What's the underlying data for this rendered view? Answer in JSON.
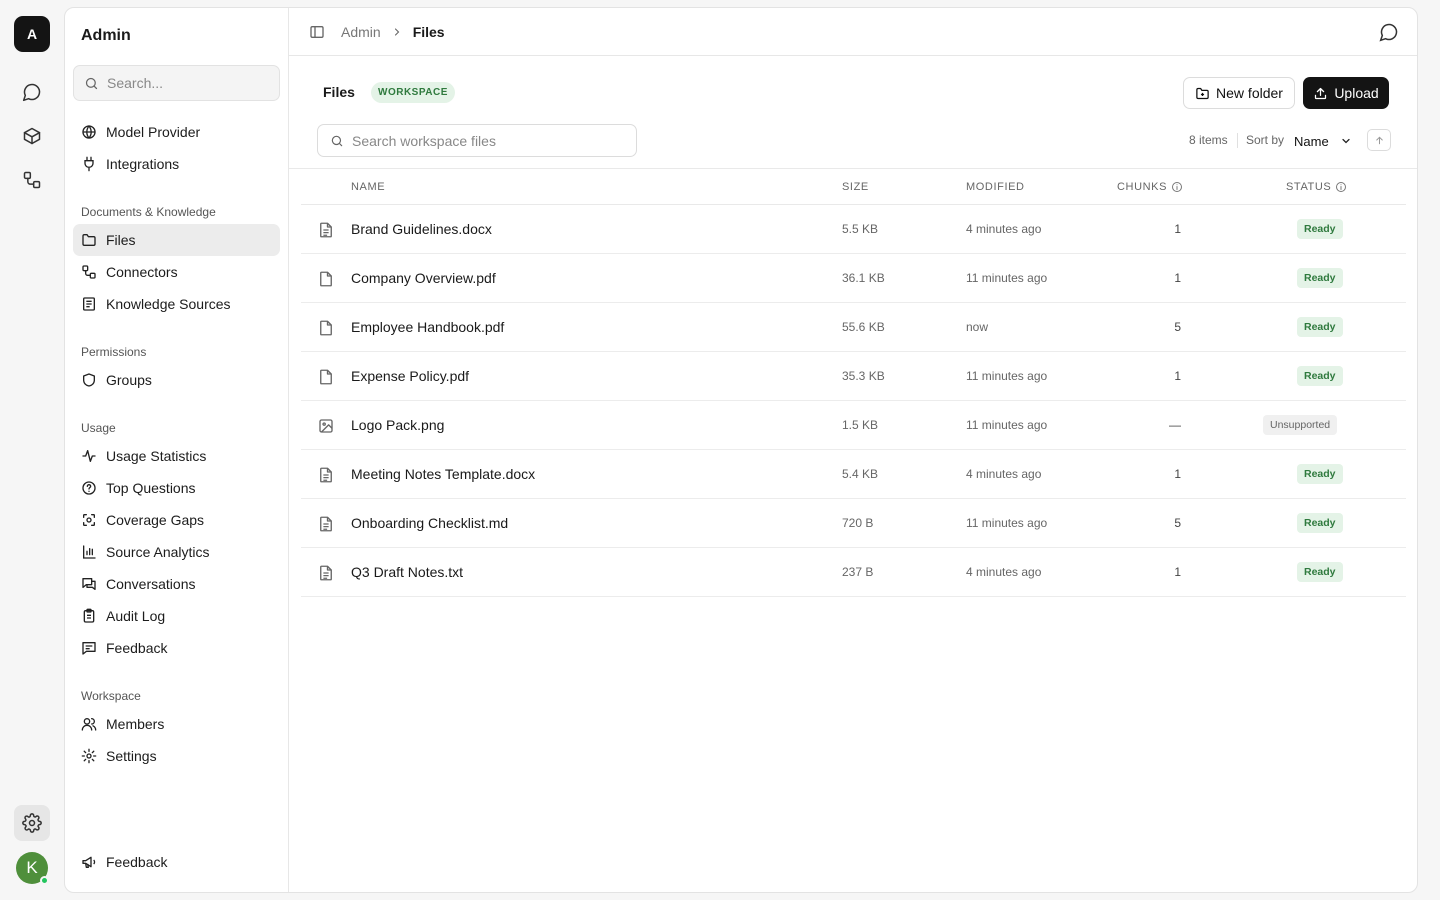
{
  "rail": {
    "logo": "A",
    "avatar": "K",
    "icons": [
      "chat-icon",
      "cube-icon",
      "workflow-icon",
      "gear-icon"
    ]
  },
  "sidebar": {
    "title": "Admin",
    "search_placeholder": "Search...",
    "top_items": [
      {
        "label": "Model Provider",
        "icon": "globe-icon"
      },
      {
        "label": "Integrations",
        "icon": "plug-icon"
      }
    ],
    "groups": [
      {
        "label": "Documents & Knowledge",
        "items": [
          {
            "label": "Files",
            "icon": "folder-icon",
            "active": true
          },
          {
            "label": "Connectors",
            "icon": "connectors-icon"
          },
          {
            "label": "Knowledge Sources",
            "icon": "book-icon"
          }
        ]
      },
      {
        "label": "Permissions",
        "items": [
          {
            "label": "Groups",
            "icon": "shield-icon"
          }
        ]
      },
      {
        "label": "Usage",
        "items": [
          {
            "label": "Usage Statistics",
            "icon": "activity-icon"
          },
          {
            "label": "Top Questions",
            "icon": "help-circle-icon"
          },
          {
            "label": "Coverage Gaps",
            "icon": "scan-icon"
          },
          {
            "label": "Source Analytics",
            "icon": "bar-chart-icon"
          },
          {
            "label": "Conversations",
            "icon": "messages-icon"
          },
          {
            "label": "Audit Log",
            "icon": "clipboard-icon"
          },
          {
            "label": "Feedback",
            "icon": "message-square-icon"
          }
        ]
      },
      {
        "label": "Workspace",
        "items": [
          {
            "label": "Members",
            "icon": "users-icon"
          },
          {
            "label": "Settings",
            "icon": "gear-icon"
          }
        ]
      }
    ],
    "bottom_item": {
      "label": "Feedback",
      "icon": "megaphone-icon"
    }
  },
  "topbar": {
    "breadcrumb": [
      "Admin",
      "Files"
    ]
  },
  "header": {
    "title": "Files",
    "badge": "WORKSPACE",
    "new_folder_label": "New folder",
    "upload_label": "Upload"
  },
  "toolbar": {
    "search_placeholder": "Search workspace files",
    "items_count": "8 items",
    "sort_by_label": "Sort by",
    "sort_value": "Name"
  },
  "table": {
    "columns": {
      "name": "NAME",
      "size": "SIZE",
      "modified": "MODIFIED",
      "chunks": "CHUNKS",
      "status": "STATUS"
    },
    "rows": [
      {
        "name": "Brand Guidelines.docx",
        "size": "5.5 KB",
        "modified": "4 minutes ago",
        "chunks": "1",
        "status": "Ready",
        "type": "doc"
      },
      {
        "name": "Company Overview.pdf",
        "size": "36.1 KB",
        "modified": "11 minutes ago",
        "chunks": "1",
        "status": "Ready",
        "type": "file"
      },
      {
        "name": "Employee Handbook.pdf",
        "size": "55.6 KB",
        "modified": "now",
        "chunks": "5",
        "status": "Ready",
        "type": "file"
      },
      {
        "name": "Expense Policy.pdf",
        "size": "35.3 KB",
        "modified": "11 minutes ago",
        "chunks": "1",
        "status": "Ready",
        "type": "file"
      },
      {
        "name": "Logo Pack.png",
        "size": "1.5 KB",
        "modified": "11 minutes ago",
        "chunks": "—",
        "status": "Unsupported",
        "type": "image"
      },
      {
        "name": "Meeting Notes Template.docx",
        "size": "5.4 KB",
        "modified": "4 minutes ago",
        "chunks": "1",
        "status": "Ready",
        "type": "doc"
      },
      {
        "name": "Onboarding Checklist.md",
        "size": "720 B",
        "modified": "11 minutes ago",
        "chunks": "5",
        "status": "Ready",
        "type": "doc"
      },
      {
        "name": "Q3 Draft Notes.txt",
        "size": "237 B",
        "modified": "4 minutes ago",
        "chunks": "1",
        "status": "Ready",
        "type": "doc"
      }
    ]
  },
  "colors": {
    "accent_dark": "#141414",
    "ready_bg": "#e4f3e7",
    "ready_text": "#2f7a3e",
    "avatar": "#4f8f3b",
    "online": "#22c55e"
  }
}
